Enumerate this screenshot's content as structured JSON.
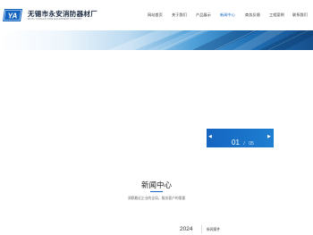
{
  "header": {
    "logo_mark_text": "YA",
    "company_name": "无锡市永安消防器材厂",
    "company_name_en": "WUXI YONGAN FIRE EQUIPMENT FACTORY",
    "brand_color": "#1565c0"
  },
  "nav": {
    "items": [
      {
        "label": "网站首页"
      },
      {
        "label": "关于我们"
      },
      {
        "label": "产品展示"
      },
      {
        "label": "新闻中心"
      },
      {
        "label": "商务反馈"
      },
      {
        "label": "工程案例"
      },
      {
        "label": "联系我们"
      }
    ],
    "active_index": 3
  },
  "slider": {
    "prev_icon": "arrow-left-icon",
    "next_icon": "arrow-right-icon",
    "current": "01",
    "separator": "/",
    "total": "05",
    "panel_color": "#1565c0"
  },
  "section": {
    "title": "新闻中心",
    "subtitle": "洞察最近企业的全局，服务客户的需要"
  },
  "news": {
    "year": "2024",
    "tab": "新闻案件"
  }
}
